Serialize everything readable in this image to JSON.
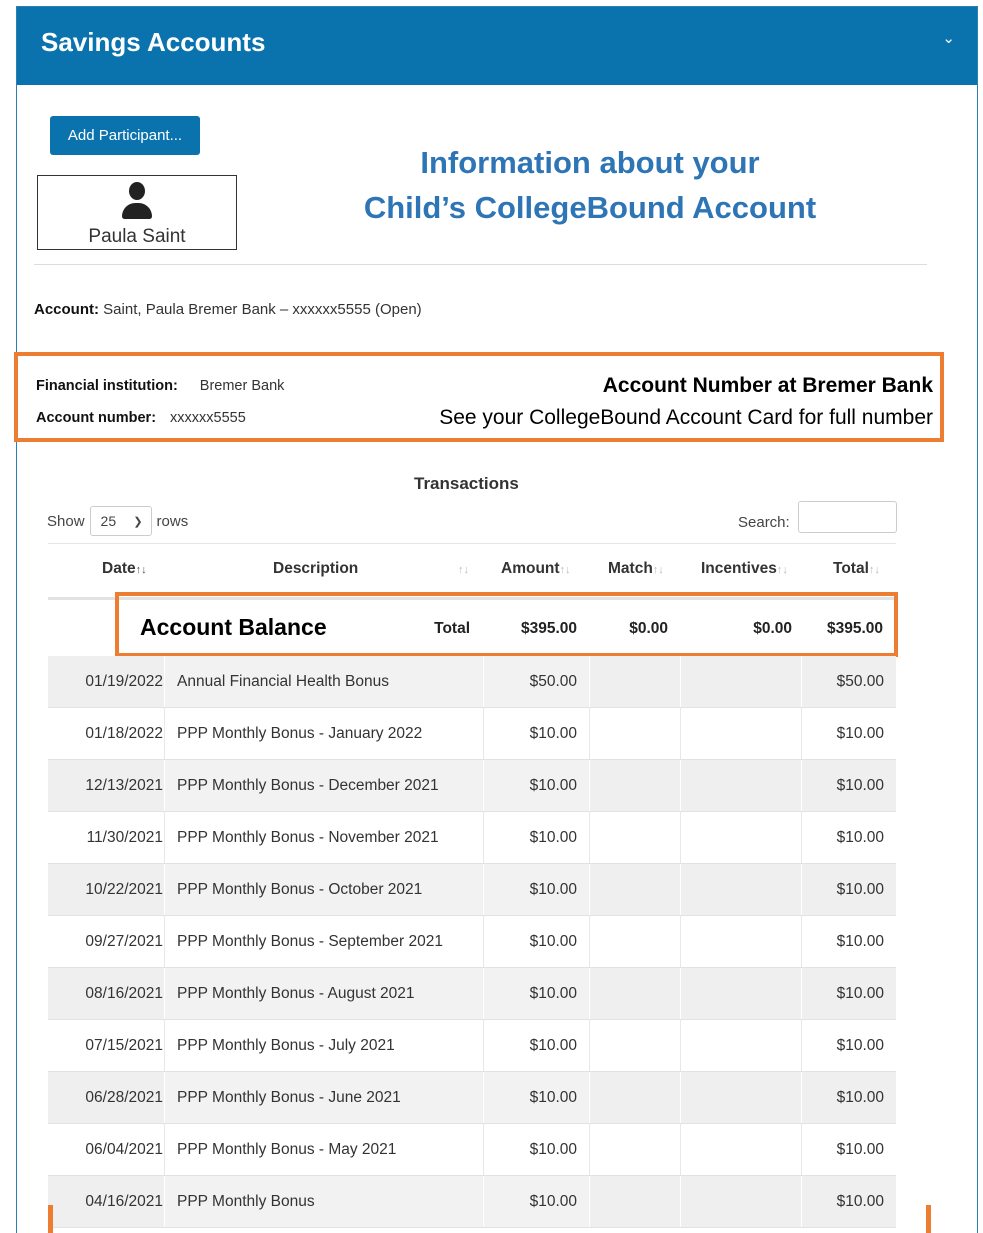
{
  "panel": {
    "title": "Savings Accounts",
    "collapse_icon": "chevron-down-icon"
  },
  "add_participant_label": "Add Participant...",
  "participant": {
    "name": "Paula Saint",
    "icon": "person-icon"
  },
  "info_heading": {
    "line1": "Information about your",
    "line2": "Child’s CollegeBound Account"
  },
  "account": {
    "label": "Account:",
    "value": "Saint, Paula  Bremer Bank – xxxxxx5555 (Open)"
  },
  "institution": {
    "fi_label": "Financial institution:",
    "fi_value": "Bremer Bank",
    "acct_label": "Account number:",
    "acct_value": "xxxxxx5555",
    "note_title": "Account Number at Bremer Bank",
    "note_sub": "See your CollegeBound Account Card for full number"
  },
  "transactions": {
    "title": "Transactions",
    "show_label": "Show",
    "rows_value": "25",
    "rows_label": "rows",
    "search_label": "Search:",
    "columns": [
      "Date",
      "Description",
      "Amount",
      "Match",
      "Incentives",
      "Total"
    ],
    "balance_label": "Account Balance",
    "totals": {
      "label": "Total",
      "amount": "$395.00",
      "match": "$0.00",
      "incentives": "$0.00",
      "total": "$395.00"
    },
    "rows": [
      {
        "date": "01/19/2022",
        "description": "Annual Financial Health Bonus",
        "amount": "$50.00",
        "match": "",
        "incentives": "",
        "total": "$50.00"
      },
      {
        "date": "01/18/2022",
        "description": "PPP Monthly Bonus - January 2022",
        "amount": "$10.00",
        "match": "",
        "incentives": "",
        "total": "$10.00"
      },
      {
        "date": "12/13/2021",
        "description": "PPP Monthly Bonus - December 2021",
        "amount": "$10.00",
        "match": "",
        "incentives": "",
        "total": "$10.00"
      },
      {
        "date": "11/30/2021",
        "description": "PPP Monthly Bonus - November 2021",
        "amount": "$10.00",
        "match": "",
        "incentives": "",
        "total": "$10.00"
      },
      {
        "date": "10/22/2021",
        "description": "PPP Monthly Bonus - October 2021",
        "amount": "$10.00",
        "match": "",
        "incentives": "",
        "total": "$10.00"
      },
      {
        "date": "09/27/2021",
        "description": "PPP Monthly Bonus - September 2021",
        "amount": "$10.00",
        "match": "",
        "incentives": "",
        "total": "$10.00"
      },
      {
        "date": "08/16/2021",
        "description": "PPP Monthly Bonus - August 2021",
        "amount": "$10.00",
        "match": "",
        "incentives": "",
        "total": "$10.00"
      },
      {
        "date": "07/15/2021",
        "description": "PPP Monthly Bonus - July 2021",
        "amount": "$10.00",
        "match": "",
        "incentives": "",
        "total": "$10.00"
      },
      {
        "date": "06/28/2021",
        "description": "PPP Monthly Bonus - June 2021",
        "amount": "$10.00",
        "match": "",
        "incentives": "",
        "total": "$10.00"
      },
      {
        "date": "06/04/2021",
        "description": "PPP Monthly Bonus - May 2021",
        "amount": "$10.00",
        "match": "",
        "incentives": "",
        "total": "$10.00"
      },
      {
        "date": "04/16/2021",
        "description": "PPP Monthly Bonus",
        "amount": "$10.00",
        "match": "",
        "incentives": "",
        "total": "$10.00"
      }
    ]
  },
  "colors": {
    "header_blue": "#0a73ae",
    "heading_blue": "#2e75b6",
    "highlight_orange": "#ed7d31"
  }
}
